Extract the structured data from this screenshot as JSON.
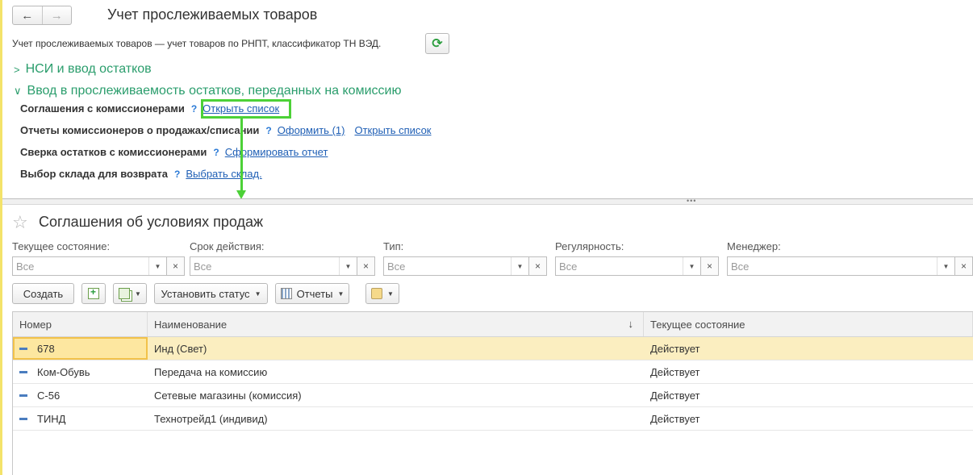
{
  "window": {
    "title": "Учет прослеживаемых товаров",
    "description": "Учет прослеживаемых товаров — учет товаров по РНПТ, классификатор ТН ВЭД."
  },
  "nav": {
    "back": "←",
    "forward": "→"
  },
  "sections": [
    {
      "label": "НСИ и ввод остатков",
      "expanded": false
    },
    {
      "label": "Ввод в прослеживаемость остатков, переданных на комиссию",
      "expanded": true
    }
  ],
  "rows": [
    {
      "label": "Соглашения с комиссионерами",
      "help": "?",
      "links": [
        "Открыть список"
      ]
    },
    {
      "label": "Отчеты комиссионеров о продажах/списании",
      "help": "?",
      "links": [
        "Оформить (1)",
        "Открыть список"
      ]
    },
    {
      "label": "Сверка остатков с комиссионерами",
      "help": "?",
      "links": [
        "Сформировать отчет"
      ]
    },
    {
      "label": "Выбор склада для возврата",
      "help": "?",
      "links": [
        "Выбрать склад."
      ]
    }
  ],
  "list": {
    "title": "Соглашения об условиях продаж",
    "filters": [
      {
        "label": "Текущее состояние:",
        "placeholder": "Все"
      },
      {
        "label": "Срок действия:",
        "placeholder": "Все"
      },
      {
        "label": "Тип:",
        "placeholder": "Все"
      },
      {
        "label": "Регулярность:",
        "placeholder": "Все"
      },
      {
        "label": "Менеджер:",
        "placeholder": "Все"
      }
    ],
    "toolbar": {
      "create": "Создать",
      "set_status": "Установить статус",
      "reports": "Отчеты"
    },
    "columns": [
      "Номер",
      "Наименование",
      "Текущее состояние"
    ],
    "sort_indicator": "↓",
    "items": [
      {
        "number": "678",
        "name": "Инд (Свет)",
        "state": "Действует",
        "selected": true
      },
      {
        "number": "Ком-Обувь",
        "name": "Передача на комиссию",
        "state": "Действует"
      },
      {
        "number": "С-56",
        "name": "Сетевые магазины (комиссия)",
        "state": "Действует"
      },
      {
        "number": "ТИНД",
        "name": "Технотрейд1 (индивид)",
        "state": "Действует"
      }
    ]
  },
  "colors": {
    "accent": "#2a9d6c",
    "highlight": "#4cd137",
    "selected_row": "#fbeec0",
    "link": "#1f5fb5"
  }
}
